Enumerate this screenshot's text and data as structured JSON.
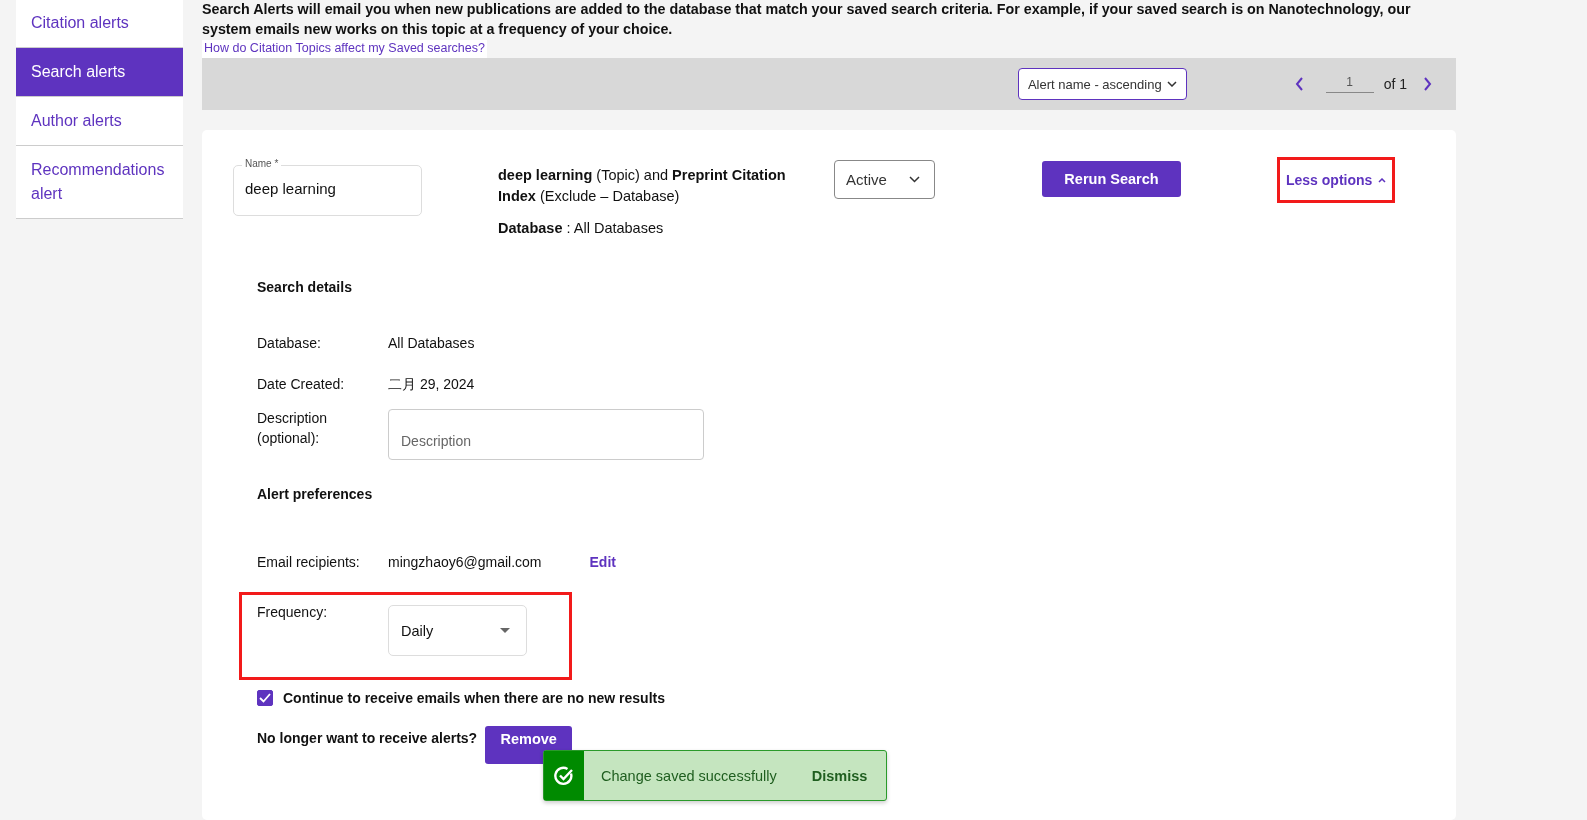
{
  "sidebar": {
    "items": [
      {
        "label": "Citation alerts",
        "selected": false
      },
      {
        "label": "Search alerts",
        "selected": true
      },
      {
        "label": "Author alerts",
        "selected": false
      },
      {
        "label": "Recommendations alert",
        "selected": false
      }
    ]
  },
  "intro": {
    "text": "Search Alerts will email you when new publications are added to the database that match your saved search criteria. For example, if your saved search is on Nanotechnology, our system emails new works on this topic at a frequency of your choice.",
    "link": "How do Citation Topics affect my Saved searches?"
  },
  "toolbar": {
    "sort": "Alert name - ascending",
    "page": "1",
    "of": "of 1"
  },
  "alert": {
    "name_label": "Name *",
    "name": "deep learning",
    "query": "**deep learning** (Topic) and **Preprint Citation Index** (Exclude – Database)",
    "database": "**Database** : All Databases",
    "status": "Active",
    "rerun": "Rerun Search",
    "toggle": {
      "label": "Less options",
      "expanded": true,
      "highlighted": true
    },
    "details": {
      "heading": "Search details",
      "rows": [
        {
          "label": "Database:",
          "value": "All Databases"
        },
        {
          "label": "Date Created:",
          "value": "二月 29, 2024"
        }
      ],
      "description": {
        "label": "Description (optional):",
        "placeholder": "Description"
      }
    },
    "preferences": {
      "heading": "Alert preferences",
      "email_label": "Email recipients:",
      "email": "mingzhaoy6@gmail.com",
      "edit": "Edit",
      "frequency": {
        "label": "Frequency:",
        "value": "Daily",
        "highlighted": true
      },
      "continue": {
        "label": "Continue to receive emails when there are no new results",
        "checked": true
      },
      "remove_prompt": "No longer want to receive alerts?",
      "remove": "Remove"
    }
  },
  "toast": {
    "message": "Change saved successfully",
    "dismiss": "Dismiss"
  }
}
